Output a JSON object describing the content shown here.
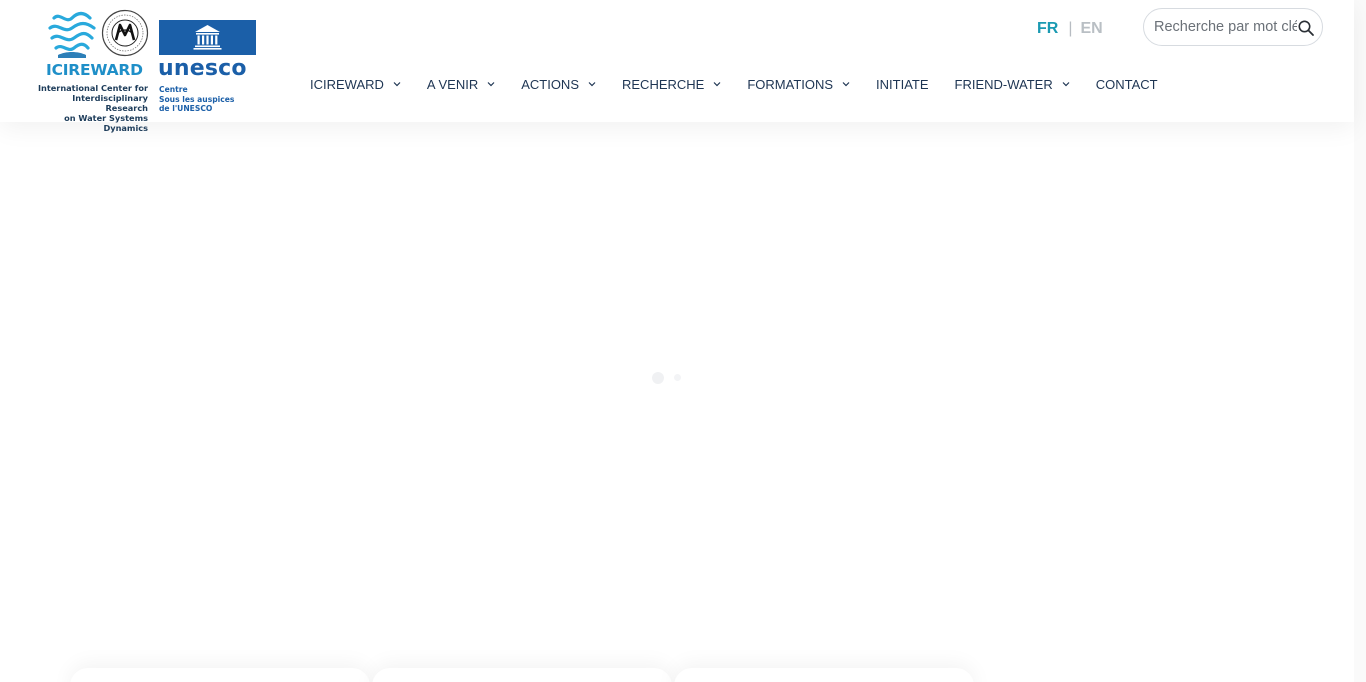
{
  "logos": {
    "icireward_name": "ICIREWARD",
    "icireward_subtitle": [
      "International Center for",
      "Interdisciplinary Research",
      "on Water Systems Dynamics"
    ],
    "unesco_name": "unesco",
    "unesco_subtitle": [
      "Centre",
      "Sous les auspices",
      "de l'UNESCO"
    ]
  },
  "language": {
    "fr": "FR",
    "separator": "|",
    "en": "EN",
    "active": "FR"
  },
  "search": {
    "placeholder": "Recherche par mot clé",
    "value": ""
  },
  "nav": {
    "items": [
      {
        "label": "ICIREWARD",
        "has_dropdown": true
      },
      {
        "label": "A VENIR",
        "has_dropdown": true
      },
      {
        "label": "ACTIONS",
        "has_dropdown": true
      },
      {
        "label": "RECHERCHE",
        "has_dropdown": true
      },
      {
        "label": "FORMATIONS",
        "has_dropdown": true
      },
      {
        "label": "INITIATE",
        "has_dropdown": false
      },
      {
        "label": "FRIEND-WATER",
        "has_dropdown": true
      },
      {
        "label": "CONTACT",
        "has_dropdown": false
      }
    ]
  },
  "colors": {
    "accent": "#1b9ab2",
    "nav_text": "#1e3553",
    "unesco_blue": "#1b5fa8",
    "icireward_blue": "#1f8fc8"
  },
  "icons": {
    "search": "search-icon",
    "dropdown": "chevron-down-icon",
    "loader": "loading-dots"
  }
}
